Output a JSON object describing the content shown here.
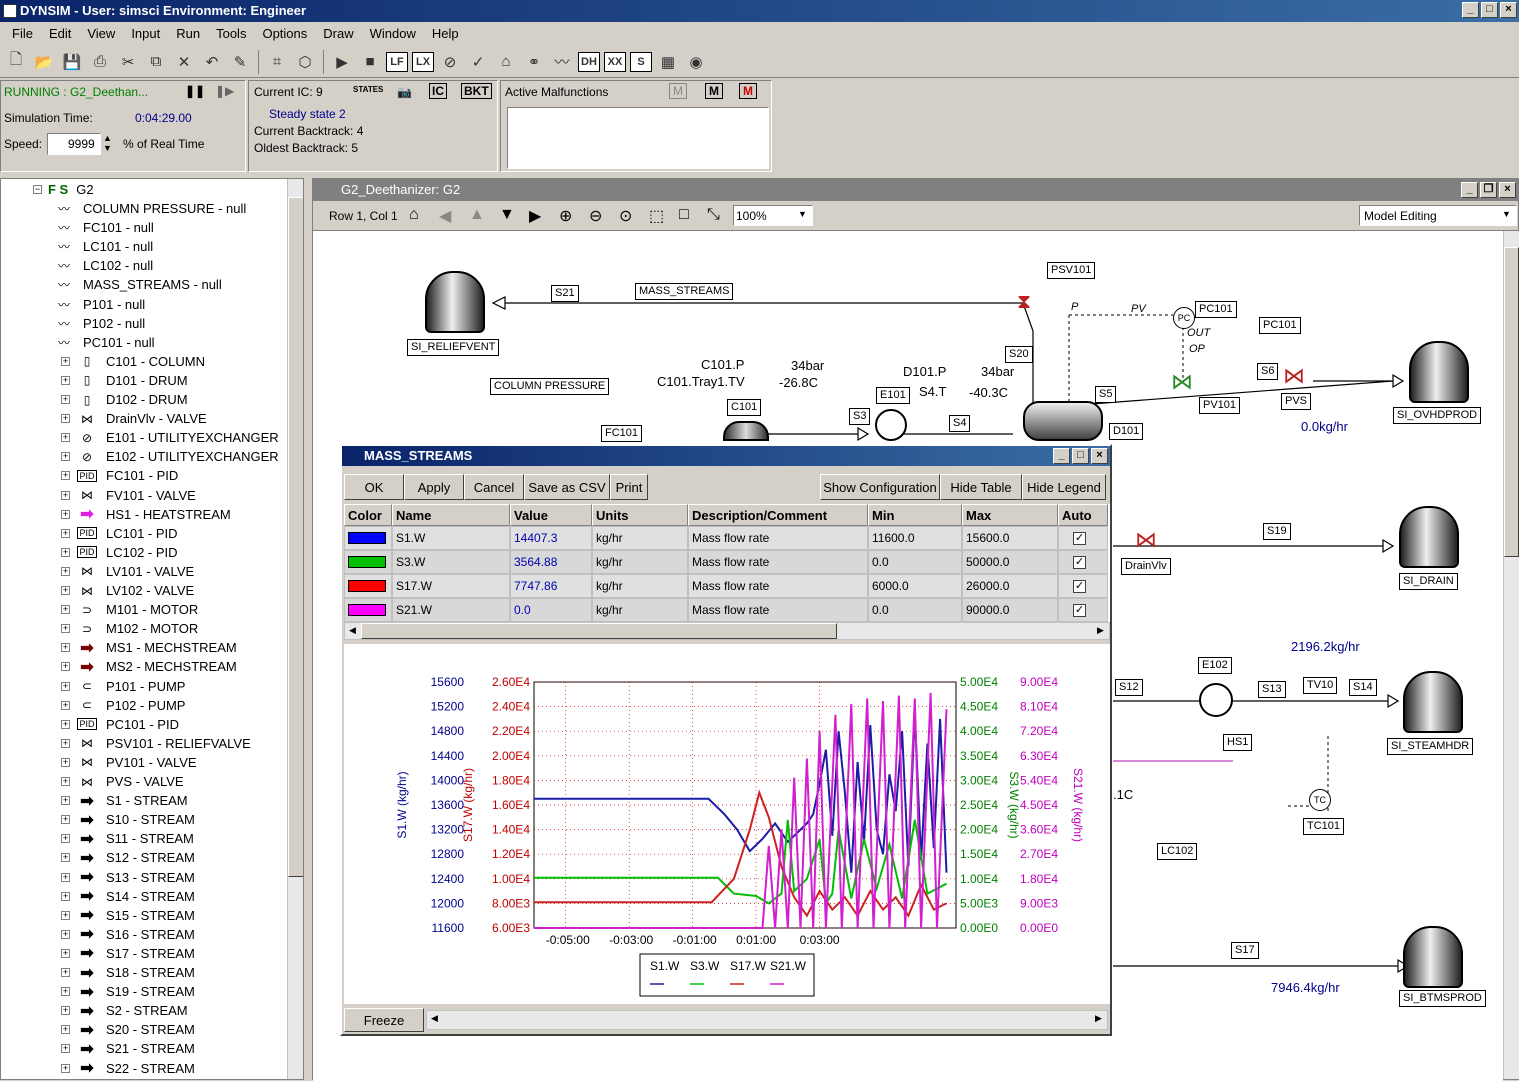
{
  "app": {
    "title": "DYNSIM - User: simsci     Environment: Engineer"
  },
  "menu": [
    "File",
    "Edit",
    "View",
    "Input",
    "Run",
    "Tools",
    "Options",
    "Draw",
    "Window",
    "Help"
  ],
  "toolbar_boxes": [
    "LF",
    "LX",
    "DH",
    "XX",
    "S"
  ],
  "status": {
    "running": "RUNNING : G2_Deethan...",
    "sim_time_label": "Simulation Time:",
    "sim_time": "0:04:29.00",
    "speed_label": "Speed:",
    "speed": "9999",
    "speed_unit": "% of Real Time",
    "current_ic": "Current IC: 9",
    "steady": "Steady state 2",
    "backtrack": "Current Backtrack: 4",
    "oldest": "Oldest Backtrack: 5",
    "ic_buttons": [
      "STATES",
      "IC",
      "BKT"
    ],
    "malfunctions": "Active Malfunctions"
  },
  "tree": {
    "root": "G2",
    "root_prefix": "F S",
    "items": [
      "COLUMN PRESSURE - null",
      "FC101 - null",
      "LC101 - null",
      "LC102 - null",
      "MASS_STREAMS - null",
      "P101 - null",
      "P102 - null",
      "PC101 - null",
      "C101 - COLUMN",
      "D101 - DRUM",
      "D102 - DRUM",
      "DrainVlv - VALVE",
      "E101 - UTILITYEXCHANGER",
      "E102 - UTILITYEXCHANGER",
      "FC101 - PID",
      "FV101 - VALVE",
      "HS1 - HEATSTREAM",
      "LC101 - PID",
      "LC102 - PID",
      "LV101 - VALVE",
      "LV102 - VALVE",
      "M101 - MOTOR",
      "M102 - MOTOR",
      "MS1 - MECHSTREAM",
      "MS2 - MECHSTREAM",
      "P101 - PUMP",
      "P102 - PUMP",
      "PC101 - PID",
      "PSV101 - RELIEFVALVE",
      "PV101 - VALVE",
      "PVS - VALVE",
      "S1 - STREAM",
      "S10 - STREAM",
      "S11 - STREAM",
      "S12 - STREAM",
      "S13 - STREAM",
      "S14 - STREAM",
      "S15 - STREAM",
      "S16 - STREAM",
      "S17 - STREAM",
      "S18 - STREAM",
      "S19 - STREAM",
      "S2 - STREAM",
      "S20 - STREAM",
      "S21 - STREAM",
      "S22 - STREAM"
    ]
  },
  "flowsheet": {
    "title": "G2_Deethanizer: G2",
    "position": "Row 1, Col 1",
    "zoom": "100%",
    "mode": "Model Editing",
    "tags": [
      "SI_RELIEFVENT",
      "S21",
      "MASS_STREAMS",
      "PSV101",
      "PC101",
      "PC101",
      "COLUMN PRESSURE",
      "C101",
      "E101",
      "S3",
      "S20",
      "S4",
      "S5",
      "D101",
      "S6",
      "PV101",
      "PVS",
      "SI_OVHDPROD",
      "FC101",
      "S19",
      "SI_DRAIN",
      "DrainVlv",
      "E102",
      "S12",
      "S13",
      "TV10",
      "S14",
      "SI_STEAMHDR",
      "HS1",
      "LC102",
      "TC101",
      "S17",
      "SI_BTMSPROD"
    ],
    "texts": {
      "c101p": "C101.P",
      "c101tray": "C101.Tray1.TV",
      "p34a": "34bar",
      "t268": "-26.8C",
      "d101p": "D101.P",
      "s4t": "S4.T",
      "p34b": "34bar",
      "t403": "-40.3C",
      "flow1": "0.0kg/hr",
      "flow2": "2196.2kg/hr",
      "flow3": "7946.4kg/hr",
      "pv": "PV",
      "p": "P",
      "out": "OUT",
      "op": "OP",
      "c1": ".1C"
    }
  },
  "dialog": {
    "title": "MASS_STREAMS",
    "buttons": [
      "OK",
      "Apply",
      "Cancel",
      "Save as CSV",
      "Print"
    ],
    "right_buttons": [
      "Show Configuration",
      "Hide Table",
      "Hide Legend"
    ],
    "columns": [
      "Color",
      "Name",
      "Value",
      "Units",
      "Description/Comment",
      "Min",
      "Max",
      "Auto"
    ],
    "rows": [
      {
        "color": "#0000ff",
        "name": "S1.W",
        "value": "14407.3",
        "units": "kg/hr",
        "desc": "Mass flow rate",
        "min": "11600.0",
        "max": "15600.0"
      },
      {
        "color": "#00c000",
        "name": "S3.W",
        "value": "3564.88",
        "units": "kg/hr",
        "desc": "Mass flow rate",
        "min": "0.0",
        "max": "50000.0"
      },
      {
        "color": "#ff0000",
        "name": "S17.W",
        "value": "7747.86",
        "units": "kg/hr",
        "desc": "Mass flow rate",
        "min": "6000.0",
        "max": "26000.0"
      },
      {
        "color": "#ff00ff",
        "name": "S21.W",
        "value": "0.0",
        "units": "kg/hr",
        "desc": "Mass flow rate",
        "min": "0.0",
        "max": "90000.0"
      }
    ],
    "freeze": "Freeze"
  },
  "chart_data": {
    "type": "line",
    "x_ticks": [
      "-0:05:00",
      "-0:03:00",
      "-0:01:00",
      "0:01:00",
      "0:03:00"
    ],
    "axes": [
      {
        "label": "S1.W (kg/hr)",
        "color": "#00008b",
        "ticks": [
          "15600",
          "15200",
          "14800",
          "14400",
          "14000",
          "13600",
          "13200",
          "12800",
          "12400",
          "12000",
          "11600"
        ]
      },
      {
        "label": "S17.W (kg/hr)",
        "color": "#c00000",
        "ticks": [
          "2.60E4",
          "2.40E4",
          "2.20E4",
          "2.00E4",
          "1.80E4",
          "1.60E4",
          "1.40E4",
          "1.20E4",
          "1.00E4",
          "8.00E3",
          "6.00E3"
        ]
      },
      {
        "label": "S3.W (kg/hr)",
        "color": "#008000",
        "ticks": [
          "5.00E4",
          "4.50E4",
          "4.00E4",
          "3.50E4",
          "3.00E4",
          "2.50E4",
          "2.00E4",
          "1.50E4",
          "1.00E4",
          "5.00E3",
          "0.00E0"
        ]
      },
      {
        "label": "S21.W (kg/hr)",
        "color": "#c000c0",
        "ticks": [
          "9.00E4",
          "8.10E4",
          "7.20E4",
          "6.30E4",
          "5.40E4",
          "4.50E4",
          "3.60E4",
          "2.70E4",
          "1.80E4",
          "9.00E3",
          "0.00E0"
        ]
      }
    ],
    "legend": [
      "S1.W",
      "S3.W",
      "S17.W",
      "S21.W"
    ],
    "series": [
      {
        "name": "S1.W",
        "color": "#1c1ca8",
        "values": [
          [
            -6,
            13700
          ],
          [
            -0.5,
            13700
          ],
          [
            0,
            13450
          ],
          [
            0.4,
            13200
          ],
          [
            0.8,
            12850
          ],
          [
            1.2,
            13050
          ],
          [
            1.6,
            13300
          ],
          [
            2,
            13000
          ],
          [
            2.3,
            13150
          ],
          [
            2.6,
            13300
          ],
          [
            2.8,
            13450
          ],
          [
            3,
            13950
          ],
          [
            3.2,
            14500
          ],
          [
            3.4,
            13100
          ],
          [
            3.6,
            14800
          ],
          [
            3.8,
            13800
          ],
          [
            4,
            12500
          ],
          [
            4.2,
            14300
          ],
          [
            4.4,
            13000
          ],
          [
            4.6,
            14900
          ],
          [
            4.8,
            13200
          ],
          [
            5,
            12800
          ],
          [
            5.2,
            14100
          ],
          [
            5.4,
            13500
          ],
          [
            5.6,
            14800
          ],
          [
            5.8,
            12600
          ],
          [
            6,
            15100
          ],
          [
            6.2,
            12700
          ],
          [
            6.4,
            14600
          ],
          [
            6.6,
            12900
          ],
          [
            6.8,
            15000
          ],
          [
            7,
            12500
          ]
        ]
      },
      {
        "name": "S3.W",
        "color": "#00c000",
        "values": [
          [
            -6,
            10200
          ],
          [
            -0.2,
            10200
          ],
          [
            0.3,
            7000
          ],
          [
            1,
            6500
          ],
          [
            1.4,
            5000
          ],
          [
            1.8,
            7000
          ],
          [
            2,
            22000
          ],
          [
            2.2,
            7500
          ],
          [
            2.6,
            10000
          ],
          [
            3,
            18000
          ],
          [
            3.2,
            5000
          ],
          [
            3.4,
            7000
          ],
          [
            3.6,
            20000
          ],
          [
            4,
            6000
          ],
          [
            4.4,
            18000
          ],
          [
            4.8,
            8000
          ],
          [
            5.2,
            17000
          ],
          [
            5.6,
            6000
          ],
          [
            6,
            22000
          ],
          [
            6.4,
            7000
          ],
          [
            7,
            9000
          ]
        ]
      },
      {
        "name": "S17.W",
        "color": "#cc2222",
        "values": [
          [
            -6,
            8100
          ],
          [
            -0.4,
            8100
          ],
          [
            0.3,
            10000
          ],
          [
            0.8,
            14000
          ],
          [
            1.1,
            17000
          ],
          [
            1.4,
            15000
          ],
          [
            1.8,
            11000
          ],
          [
            2.2,
            8500
          ],
          [
            2.6,
            7000
          ],
          [
            3,
            9000
          ],
          [
            3.4,
            7500
          ],
          [
            3.8,
            8500
          ],
          [
            4.2,
            7000
          ],
          [
            4.6,
            9000
          ],
          [
            5,
            7500
          ],
          [
            5.4,
            8500
          ],
          [
            5.8,
            7000
          ],
          [
            6.2,
            9500
          ],
          [
            6.6,
            7500
          ],
          [
            7,
            8000
          ]
        ]
      },
      {
        "name": "S21.W",
        "color": "#d020d0",
        "values": [
          [
            -6,
            0
          ],
          [
            1.2,
            0
          ],
          [
            1.4,
            30000
          ],
          [
            1.6,
            0
          ],
          [
            1.8,
            36000
          ],
          [
            2,
            0
          ],
          [
            2.2,
            55000
          ],
          [
            2.4,
            0
          ],
          [
            2.6,
            62000
          ],
          [
            2.8,
            0
          ],
          [
            3,
            72000
          ],
          [
            3.2,
            0
          ],
          [
            3.5,
            78000
          ],
          [
            3.7,
            0
          ],
          [
            4,
            82000
          ],
          [
            4.2,
            0
          ],
          [
            4.5,
            84000
          ],
          [
            4.7,
            0
          ],
          [
            5,
            83000
          ],
          [
            5.2,
            0
          ],
          [
            5.5,
            85000
          ],
          [
            5.7,
            0
          ],
          [
            6,
            84000
          ],
          [
            6.2,
            0
          ],
          [
            6.5,
            86000
          ],
          [
            6.7,
            0
          ],
          [
            7,
            80000
          ]
        ]
      }
    ]
  }
}
